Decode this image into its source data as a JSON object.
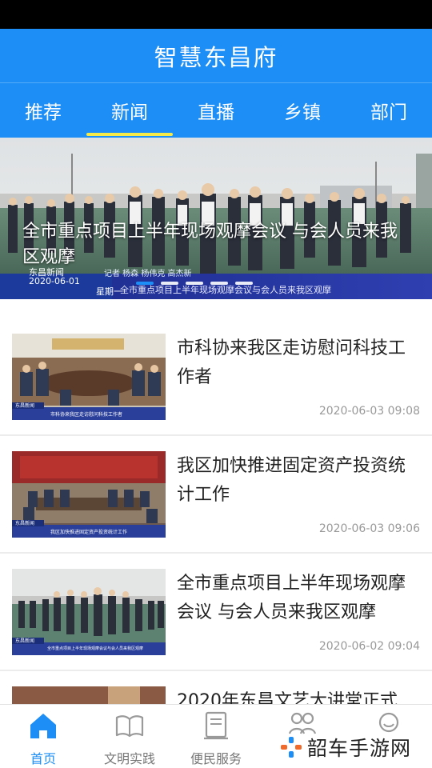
{
  "app": {
    "title": "智慧东昌府"
  },
  "tabs": [
    {
      "label": "推荐"
    },
    {
      "label": "新闻"
    },
    {
      "label": "直播"
    },
    {
      "label": "乡镇"
    },
    {
      "label": "部门"
    }
  ],
  "active_tab": "新闻",
  "banner": {
    "caption": "全市重点项目上半年现场观摩会议  与会人员来我区观摩",
    "station": "东昌新闻",
    "date": "2020-06-01",
    "weekday": "星期一",
    "credit": "记者 杨森 杨伟克 高杰新",
    "ticker": "全市重点项目上半年现场观摩会议与会人员来我区观摩",
    "slide_count": 5,
    "active_slide": 1
  },
  "news": [
    {
      "title": "市科协来我区走访慰问科技工作者",
      "time": "2020-06-03 09:08",
      "thumb_caption": "市科协来我区走访慰问科技工作者",
      "thumb_station": "东昌新闻"
    },
    {
      "title": "我区加快推进固定资产投资统计工作",
      "time": "2020-06-03 09:06",
      "thumb_caption": "我区加快推进固定资产投资统计工作",
      "thumb_station": "东昌新闻"
    },
    {
      "title": "全市重点项目上半年现场观摩会议  与会人员来我区观摩",
      "time": "2020-06-02 09:04",
      "thumb_caption": "全市重点项目上半年现场观摩会议与会人员来我区观摩",
      "thumb_station": "东昌新闻"
    },
    {
      "title": "2020年东昌文艺大讲堂正式",
      "time": "",
      "thumb_caption": "",
      "thumb_station": ""
    }
  ],
  "bottom_nav": [
    {
      "label": "首页",
      "icon": "home-icon"
    },
    {
      "label": "文明实践",
      "icon": "book-icon"
    },
    {
      "label": "便民服务",
      "icon": "document-icon"
    },
    {
      "label": "",
      "icon": "group-icon"
    },
    {
      "label": "",
      "icon": "smiley-icon"
    }
  ],
  "watermark": {
    "text": "韶车手游网"
  },
  "colors": {
    "primary": "#1c8ef5",
    "tab_indicator": "#f6ea49",
    "muted": "#999999"
  }
}
